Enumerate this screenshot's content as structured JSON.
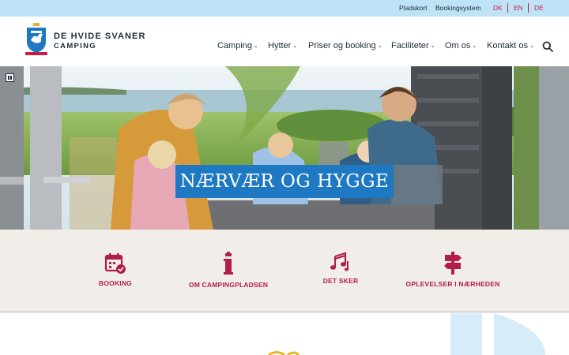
{
  "topbar": {
    "links": [
      "Pladskort",
      "Bookingsystem"
    ],
    "languages": [
      "DK",
      "EN",
      "DE"
    ]
  },
  "brand": {
    "line1": "DE HVIDE SVANER",
    "line2": "CAMPING"
  },
  "nav": {
    "items": [
      "Camping",
      "Hytter",
      "Priser og booking",
      "Faciliteter",
      "Om os",
      "Kontakt os"
    ]
  },
  "hero": {
    "title": "NÆRVÆR OG HYGGE"
  },
  "quick_links": [
    {
      "label": "BOOKING",
      "icon": "calendar-check-icon"
    },
    {
      "label": "OM CAMPINGPLADSEN",
      "icon": "info-icon"
    },
    {
      "label": "DET SKER",
      "icon": "music-notes-icon"
    },
    {
      "label": "OPLEVELSER I NÆRHEDEN",
      "icon": "signpost-icon"
    }
  ],
  "colors": {
    "topbar": "#bfe3f6",
    "accent": "#c41d4a",
    "hero_banner": "#1e79c2",
    "quick_bg": "#f1ede8",
    "text": "#1d2b3a"
  }
}
